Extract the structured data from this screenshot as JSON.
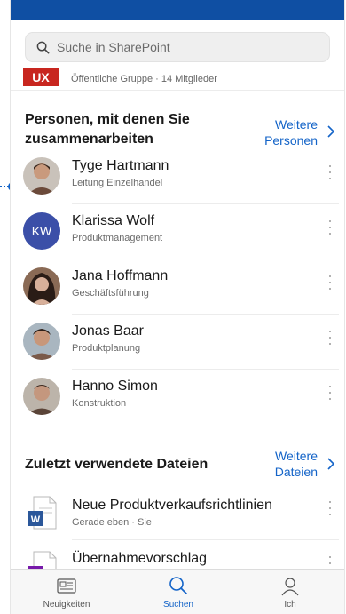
{
  "search": {
    "placeholder": "Suche in SharePoint"
  },
  "group": {
    "logo": "UX",
    "subtitle": "Öffentliche Gruppe · 14 Mitglieder"
  },
  "people_section": {
    "title_line1": "Personen, mit denen Sie",
    "title_line2": "zusammenarbeiten",
    "more_line1": "Weitere",
    "more_line2": "Personen",
    "people": [
      {
        "name": "Tyge Hartmann",
        "role": "Leitung Einzelhandel",
        "avatar": "photo",
        "color": "#6b4a3a"
      },
      {
        "name": "Klarissa Wolf",
        "role": "Produktmanagement",
        "avatar": "initials",
        "initials": "KW",
        "color": "#3b4fa8"
      },
      {
        "name": "Jana Hoffmann",
        "role": "Geschäftsführung",
        "avatar": "photo",
        "color": "#3a2a22"
      },
      {
        "name": "Jonas Baar",
        "role": "Produktplanung",
        "avatar": "photo",
        "color": "#7a5a4a"
      },
      {
        "name": "Hanno Simon",
        "role": "Konstruktion",
        "avatar": "photo",
        "color": "#5a4438"
      }
    ]
  },
  "files_section": {
    "title": "Zuletzt verwendete Dateien",
    "more_line1": "Weitere",
    "more_line2": "Dateien",
    "files": [
      {
        "name": "Neue Produktverkaufsrichtlinien",
        "meta": "Gerade eben · Sie",
        "icon": "word-icon",
        "color": "#2b579a"
      },
      {
        "name": "Übernahmevorschlag",
        "meta": "",
        "icon": "onenote-icon",
        "color": "#7719aa"
      }
    ]
  },
  "tabs": [
    {
      "label": "Neuigkeiten",
      "icon": "news-icon"
    },
    {
      "label": "Suchen",
      "icon": "search-icon"
    },
    {
      "label": "Ich",
      "icon": "person-icon"
    }
  ],
  "colors": {
    "accent": "#1464c8",
    "topbar": "#0f4fa3",
    "ux": "#c8261f",
    "hotspot": "#1464c8"
  }
}
